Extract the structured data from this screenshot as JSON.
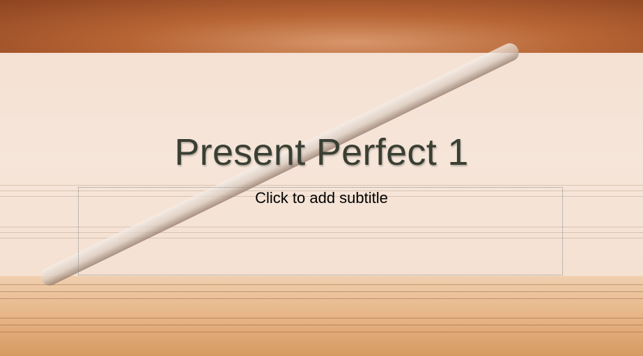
{
  "slide": {
    "title": "Present Perfect 1",
    "subtitle_placeholder": "Click to add subtitle"
  },
  "colors": {
    "title_text": "#3a3f33",
    "band_overlay": "#f6e5da",
    "top_strip": "#b76535"
  }
}
